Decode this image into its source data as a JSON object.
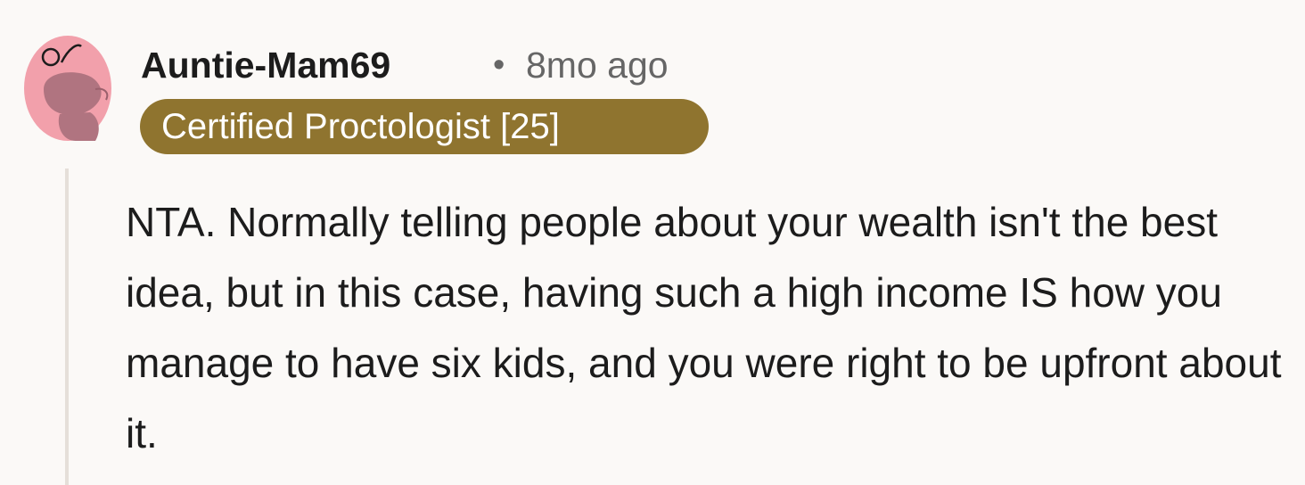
{
  "comment": {
    "author": "Auntie-Mam69",
    "separator": "•",
    "timestamp": "8mo ago",
    "flair": "Certified Proctologist [25]",
    "body": "NTA. Normally telling people about your wealth isn't the best idea, but in this case, having such a high income IS how you manage to have six kids, and you were right to be upfront about it.",
    "avatar_icon": "snoo-avatar-icon"
  },
  "colors": {
    "background": "#fbf9f7",
    "avatar_bg": "#f2a0ab",
    "avatar_figure": "#b07480",
    "flair_bg": "#8f742f",
    "flair_text": "#ffffff",
    "author_text": "#1c1c1c",
    "meta_text": "#666666",
    "thread_line": "#e5dfd9"
  }
}
